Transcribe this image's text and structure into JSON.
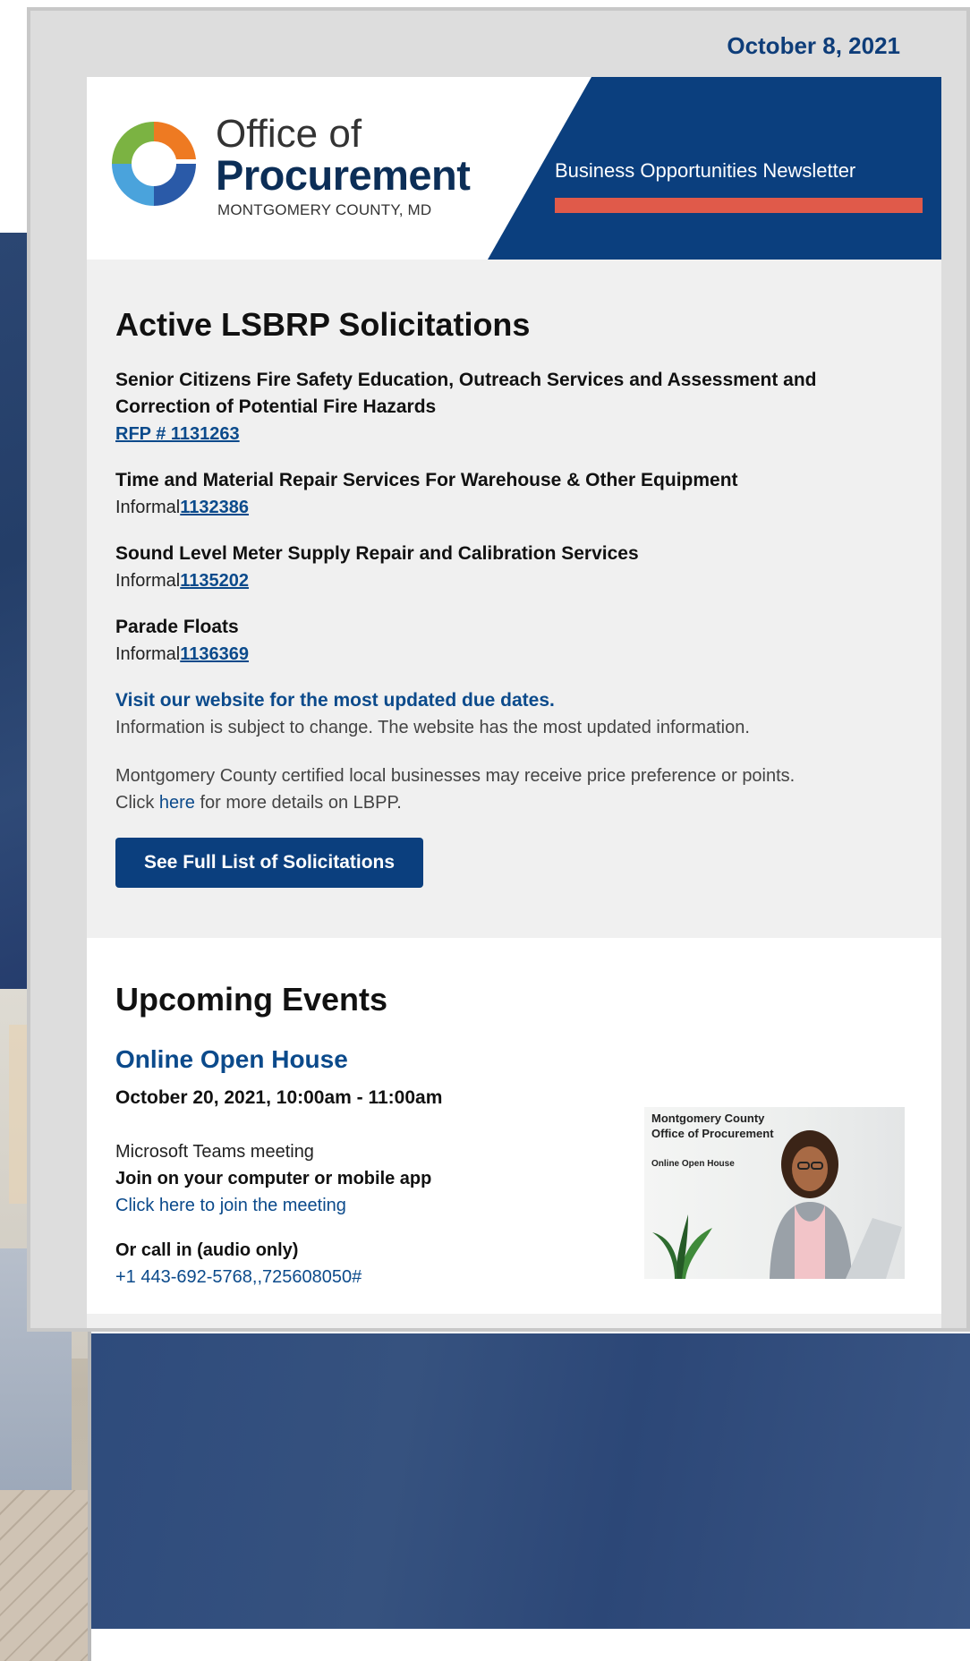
{
  "newsletter": {
    "date": "October 8, 2021",
    "logo": {
      "line1": "Office of",
      "line2": "Procurement",
      "line3": "MONTGOMERY COUNTY, MD"
    },
    "title": "Business Opportunities Newsletter"
  },
  "solicitations": {
    "heading": "Active LSBRP Solicitations",
    "items": [
      {
        "title": "Senior Citizens Fire Safety Education, Outreach Services and Assessment and Correction of Potential Fire Hazards",
        "prefix": "",
        "number": "RFP # 1131263"
      },
      {
        "title": "Time and Material Repair Services For Warehouse & Other Equipment",
        "prefix": "Informal",
        "number": "1132386"
      },
      {
        "title": "Sound Level Meter Supply Repair and Calibration Services",
        "prefix": "Informal",
        "number": "1135202"
      },
      {
        "title": "Parade Floats",
        "prefix": "Informal",
        "number": "1136369"
      }
    ],
    "website_link": "Visit our website for the most updated due dates.",
    "disclaimer": "Information is subject to change. The website has the most updated information.",
    "lbpp_text_1": "Montgomery County certified local businesses may receive price preference or points.",
    "lbpp_click": "Click ",
    "lbpp_link": "here",
    "lbpp_text_2": " for more details on LBPP.",
    "cta_label": "See Full List of Solicitations"
  },
  "events": {
    "heading": "Upcoming Events",
    "event": {
      "title": "Online Open House",
      "date": "October 20, 2021, 10:00am - 11:00am",
      "meeting_type": "Microsoft Teams meeting",
      "join_heading": "Join on your computer or mobile app",
      "join_link": "Click here to join the meeting",
      "call_heading": "Or call in (audio only)",
      "phone": "+1 443-692-5768,,725608050#"
    },
    "image": {
      "line1": "Montgomery County",
      "line2": "Office of Procurement",
      "line3": "Online Open House"
    }
  },
  "colors": {
    "brand_navy": "#0b3f7e",
    "link_blue": "#0b4a8b",
    "accent_coral": "#e05a4a",
    "logo_orange": "#ee7a22",
    "logo_green": "#7bb342",
    "logo_blue": "#3a78c2"
  }
}
